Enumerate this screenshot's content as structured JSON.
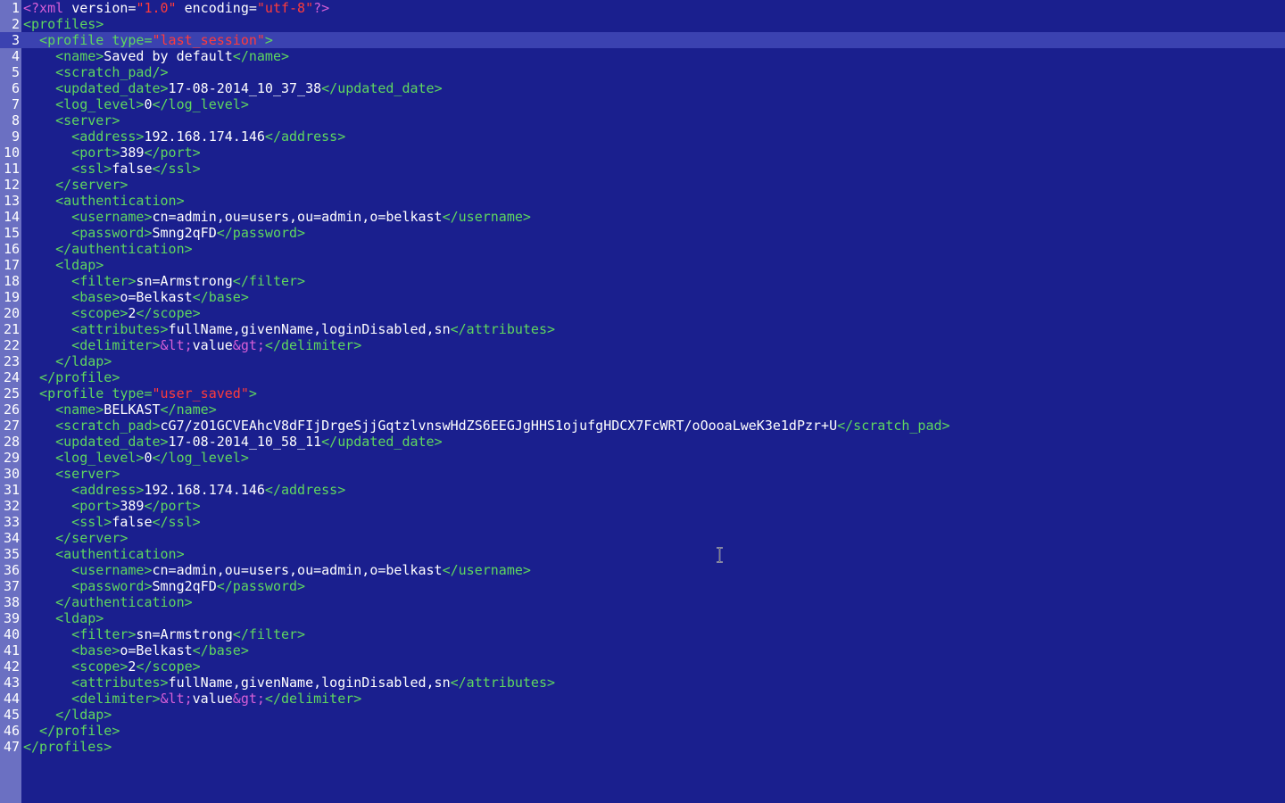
{
  "editor": {
    "current_line": 3,
    "lines": [
      {
        "n": "1",
        "indent": 0,
        "tokens": [
          {
            "t": "<?xml ",
            "c": "pi"
          },
          {
            "t": "version=",
            "c": "attr"
          },
          {
            "t": "\"1.0\"",
            "c": "str"
          },
          {
            "t": " encoding=",
            "c": "attr"
          },
          {
            "t": "\"utf-8\"",
            "c": "str"
          },
          {
            "t": "?>",
            "c": "pi"
          }
        ]
      },
      {
        "n": "2",
        "indent": 0,
        "tokens": [
          {
            "t": "<profiles>",
            "c": "tag"
          }
        ]
      },
      {
        "n": "3",
        "indent": 1,
        "tokens": [
          {
            "t": "<profile ",
            "c": "tag"
          },
          {
            "t": "type=",
            "c": "tag"
          },
          {
            "t": "\"last_session\"",
            "c": "str"
          },
          {
            "t": ">",
            "c": "tag"
          }
        ]
      },
      {
        "n": "4",
        "indent": 2,
        "tokens": [
          {
            "t": "<name>",
            "c": "tag"
          },
          {
            "t": "Saved by default",
            "c": "text"
          },
          {
            "t": "</name>",
            "c": "tag"
          }
        ]
      },
      {
        "n": "5",
        "indent": 2,
        "tokens": [
          {
            "t": "<scratch_pad/>",
            "c": "tag"
          }
        ]
      },
      {
        "n": "6",
        "indent": 2,
        "tokens": [
          {
            "t": "<updated_date>",
            "c": "tag"
          },
          {
            "t": "17-08-2014_10_37_38",
            "c": "text"
          },
          {
            "t": "</updated_date>",
            "c": "tag"
          }
        ]
      },
      {
        "n": "7",
        "indent": 2,
        "tokens": [
          {
            "t": "<log_level>",
            "c": "tag"
          },
          {
            "t": "0",
            "c": "text"
          },
          {
            "t": "</log_level>",
            "c": "tag"
          }
        ]
      },
      {
        "n": "8",
        "indent": 2,
        "tokens": [
          {
            "t": "<server>",
            "c": "tag"
          }
        ]
      },
      {
        "n": "9",
        "indent": 3,
        "tokens": [
          {
            "t": "<address>",
            "c": "tag"
          },
          {
            "t": "192.168.174.146",
            "c": "text"
          },
          {
            "t": "</address>",
            "c": "tag"
          }
        ]
      },
      {
        "n": "10",
        "indent": 3,
        "tokens": [
          {
            "t": "<port>",
            "c": "tag"
          },
          {
            "t": "389",
            "c": "text"
          },
          {
            "t": "</port>",
            "c": "tag"
          }
        ]
      },
      {
        "n": "11",
        "indent": 3,
        "tokens": [
          {
            "t": "<ssl>",
            "c": "tag"
          },
          {
            "t": "false",
            "c": "text"
          },
          {
            "t": "</ssl>",
            "c": "tag"
          }
        ]
      },
      {
        "n": "12",
        "indent": 2,
        "tokens": [
          {
            "t": "</server>",
            "c": "tag"
          }
        ]
      },
      {
        "n": "13",
        "indent": 2,
        "tokens": [
          {
            "t": "<authentication>",
            "c": "tag"
          }
        ]
      },
      {
        "n": "14",
        "indent": 3,
        "tokens": [
          {
            "t": "<username>",
            "c": "tag"
          },
          {
            "t": "cn=admin,ou=users,ou=admin,o=belkast",
            "c": "text"
          },
          {
            "t": "</username>",
            "c": "tag"
          }
        ]
      },
      {
        "n": "15",
        "indent": 3,
        "tokens": [
          {
            "t": "<password>",
            "c": "tag"
          },
          {
            "t": "Smng2qFD",
            "c": "text"
          },
          {
            "t": "</password>",
            "c": "tag"
          }
        ]
      },
      {
        "n": "16",
        "indent": 2,
        "tokens": [
          {
            "t": "</authentication>",
            "c": "tag"
          }
        ]
      },
      {
        "n": "17",
        "indent": 2,
        "tokens": [
          {
            "t": "<ldap>",
            "c": "tag"
          }
        ]
      },
      {
        "n": "18",
        "indent": 3,
        "tokens": [
          {
            "t": "<filter>",
            "c": "tag"
          },
          {
            "t": "sn=Armstrong",
            "c": "text"
          },
          {
            "t": "</filter>",
            "c": "tag"
          }
        ]
      },
      {
        "n": "19",
        "indent": 3,
        "tokens": [
          {
            "t": "<base>",
            "c": "tag"
          },
          {
            "t": "o=Belkast",
            "c": "text"
          },
          {
            "t": "</base>",
            "c": "tag"
          }
        ]
      },
      {
        "n": "20",
        "indent": 3,
        "tokens": [
          {
            "t": "<scope>",
            "c": "tag"
          },
          {
            "t": "2",
            "c": "text"
          },
          {
            "t": "</scope>",
            "c": "tag"
          }
        ]
      },
      {
        "n": "21",
        "indent": 3,
        "tokens": [
          {
            "t": "<attributes>",
            "c": "tag"
          },
          {
            "t": "fullName,givenName,loginDisabled,sn",
            "c": "text"
          },
          {
            "t": "</attributes>",
            "c": "tag"
          }
        ]
      },
      {
        "n": "22",
        "indent": 3,
        "tokens": [
          {
            "t": "<delimiter>",
            "c": "tag"
          },
          {
            "t": "&lt;",
            "c": "ent"
          },
          {
            "t": "value",
            "c": "text"
          },
          {
            "t": "&gt;",
            "c": "ent"
          },
          {
            "t": "</delimiter>",
            "c": "tag"
          }
        ]
      },
      {
        "n": "23",
        "indent": 2,
        "tokens": [
          {
            "t": "</ldap>",
            "c": "tag"
          }
        ]
      },
      {
        "n": "24",
        "indent": 1,
        "tokens": [
          {
            "t": "</profile>",
            "c": "tag"
          }
        ]
      },
      {
        "n": "25",
        "indent": 1,
        "tokens": [
          {
            "t": "<profile ",
            "c": "tag"
          },
          {
            "t": "type=",
            "c": "tag"
          },
          {
            "t": "\"user_saved\"",
            "c": "str"
          },
          {
            "t": ">",
            "c": "tag"
          }
        ]
      },
      {
        "n": "26",
        "indent": 2,
        "tokens": [
          {
            "t": "<name>",
            "c": "tag"
          },
          {
            "t": "BELKAST",
            "c": "text"
          },
          {
            "t": "</name>",
            "c": "tag"
          }
        ]
      },
      {
        "n": "27",
        "indent": 2,
        "tokens": [
          {
            "t": "<scratch_pad>",
            "c": "tag"
          },
          {
            "t": "cG7/zO1GCVEAhcV8dFIjDrgeSjjGqtzlvnswHdZS6EEGJgHHS1ojufgHDCX7FcWRT/oOooaLweK3e1dPzr+U",
            "c": "text"
          },
          {
            "t": "</scratch_pad>",
            "c": "tag"
          }
        ]
      },
      {
        "n": "28",
        "indent": 2,
        "tokens": [
          {
            "t": "<updated_date>",
            "c": "tag"
          },
          {
            "t": "17-08-2014_10_58_11",
            "c": "text"
          },
          {
            "t": "</updated_date>",
            "c": "tag"
          }
        ]
      },
      {
        "n": "29",
        "indent": 2,
        "tokens": [
          {
            "t": "<log_level>",
            "c": "tag"
          },
          {
            "t": "0",
            "c": "text"
          },
          {
            "t": "</log_level>",
            "c": "tag"
          }
        ]
      },
      {
        "n": "30",
        "indent": 2,
        "tokens": [
          {
            "t": "<server>",
            "c": "tag"
          }
        ]
      },
      {
        "n": "31",
        "indent": 3,
        "tokens": [
          {
            "t": "<address>",
            "c": "tag"
          },
          {
            "t": "192.168.174.146",
            "c": "text"
          },
          {
            "t": "</address>",
            "c": "tag"
          }
        ]
      },
      {
        "n": "32",
        "indent": 3,
        "tokens": [
          {
            "t": "<port>",
            "c": "tag"
          },
          {
            "t": "389",
            "c": "text"
          },
          {
            "t": "</port>",
            "c": "tag"
          }
        ]
      },
      {
        "n": "33",
        "indent": 3,
        "tokens": [
          {
            "t": "<ssl>",
            "c": "tag"
          },
          {
            "t": "false",
            "c": "text"
          },
          {
            "t": "</ssl>",
            "c": "tag"
          }
        ]
      },
      {
        "n": "34",
        "indent": 2,
        "tokens": [
          {
            "t": "</server>",
            "c": "tag"
          }
        ]
      },
      {
        "n": "35",
        "indent": 2,
        "tokens": [
          {
            "t": "<authentication>",
            "c": "tag"
          }
        ]
      },
      {
        "n": "36",
        "indent": 3,
        "tokens": [
          {
            "t": "<username>",
            "c": "tag"
          },
          {
            "t": "cn=admin,ou=users,ou=admin,o=belkast",
            "c": "text"
          },
          {
            "t": "</username>",
            "c": "tag"
          }
        ]
      },
      {
        "n": "37",
        "indent": 3,
        "tokens": [
          {
            "t": "<password>",
            "c": "tag"
          },
          {
            "t": "Smng2qFD",
            "c": "text"
          },
          {
            "t": "</password>",
            "c": "tag"
          }
        ]
      },
      {
        "n": "38",
        "indent": 2,
        "tokens": [
          {
            "t": "</authentication>",
            "c": "tag"
          }
        ]
      },
      {
        "n": "39",
        "indent": 2,
        "tokens": [
          {
            "t": "<ldap>",
            "c": "tag"
          }
        ]
      },
      {
        "n": "40",
        "indent": 3,
        "tokens": [
          {
            "t": "<filter>",
            "c": "tag"
          },
          {
            "t": "sn=Armstrong",
            "c": "text"
          },
          {
            "t": "</filter>",
            "c": "tag"
          }
        ]
      },
      {
        "n": "41",
        "indent": 3,
        "tokens": [
          {
            "t": "<base>",
            "c": "tag"
          },
          {
            "t": "o=Belkast",
            "c": "text"
          },
          {
            "t": "</base>",
            "c": "tag"
          }
        ]
      },
      {
        "n": "42",
        "indent": 3,
        "tokens": [
          {
            "t": "<scope>",
            "c": "tag"
          },
          {
            "t": "2",
            "c": "text"
          },
          {
            "t": "</scope>",
            "c": "tag"
          }
        ]
      },
      {
        "n": "43",
        "indent": 3,
        "tokens": [
          {
            "t": "<attributes>",
            "c": "tag"
          },
          {
            "t": "fullName,givenName,loginDisabled,sn",
            "c": "text"
          },
          {
            "t": "</attributes>",
            "c": "tag"
          }
        ]
      },
      {
        "n": "44",
        "indent": 3,
        "tokens": [
          {
            "t": "<delimiter>",
            "c": "tag"
          },
          {
            "t": "&lt;",
            "c": "ent"
          },
          {
            "t": "value",
            "c": "text"
          },
          {
            "t": "&gt;",
            "c": "ent"
          },
          {
            "t": "</delimiter>",
            "c": "tag"
          }
        ]
      },
      {
        "n": "45",
        "indent": 2,
        "tokens": [
          {
            "t": "</ldap>",
            "c": "tag"
          }
        ]
      },
      {
        "n": "46",
        "indent": 1,
        "tokens": [
          {
            "t": "</profile>",
            "c": "tag"
          }
        ]
      },
      {
        "n": "47",
        "indent": 0,
        "tokens": [
          {
            "t": "</profiles>",
            "c": "tag"
          }
        ]
      }
    ]
  },
  "colors": {
    "background": "#1a1f8e",
    "gutter": "#6b70c2",
    "current_line": "#3b42b0",
    "tag": "#5fd75f",
    "string": "#ff3b3b",
    "entity": "#d75fd7",
    "text": "#ffffff"
  },
  "icons": {
    "mouse_cursor": "i-beam-cursor-icon"
  }
}
